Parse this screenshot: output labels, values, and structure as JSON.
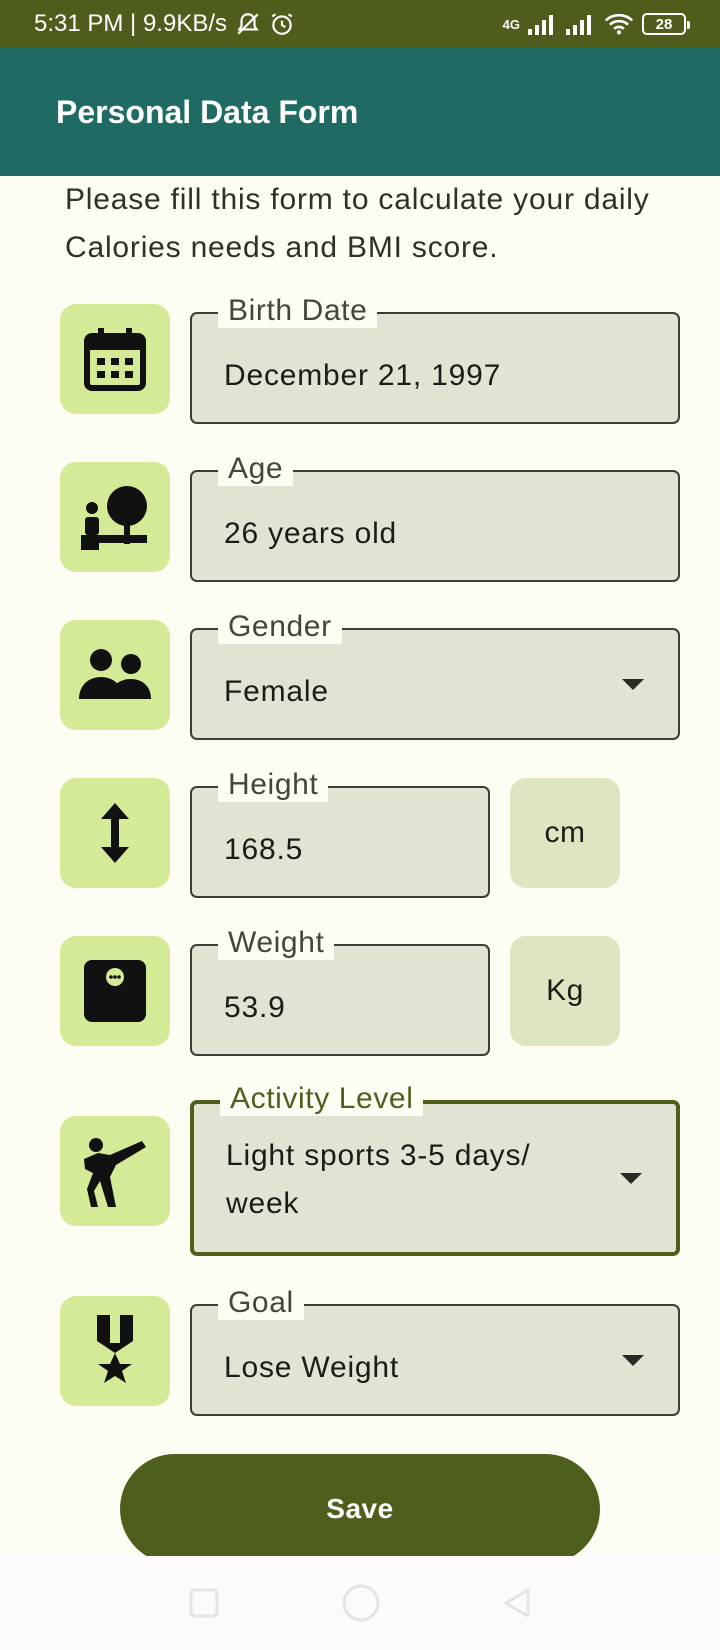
{
  "status_bar": {
    "time_speed": "5:31 PM | 9.9KB/s",
    "network": "4G",
    "battery": "28"
  },
  "app_bar": {
    "title": "Personal Data Form"
  },
  "intro_text": "Please fill this form to calculate your daily Calories needs and BMI score.",
  "fields": {
    "birth_date": {
      "label": "Birth Date",
      "value": "December 21, 1997",
      "icon": "calendar-icon"
    },
    "age": {
      "label": "Age",
      "value": "26 years old",
      "icon": "child-tree-icon"
    },
    "gender": {
      "label": "Gender",
      "value": "Female",
      "icon": "people-icon"
    },
    "height": {
      "label": "Height",
      "value": "168.5",
      "unit": "cm",
      "icon": "height-arrow-icon"
    },
    "weight": {
      "label": "Weight",
      "value": "53.9",
      "unit": "Kg",
      "icon": "scale-icon"
    },
    "activity": {
      "label": "Activity Level",
      "value": "Light sports 3-5 days/ week",
      "icon": "kick-icon"
    },
    "goal": {
      "label": "Goal",
      "value": "Lose Weight",
      "icon": "medal-icon"
    }
  },
  "save_label": "Save",
  "colors": {
    "status_bar": "#4e5d1b",
    "app_bar": "#1f6b63",
    "icon_box": "#d5ea96",
    "field_bg": "#e1e4d2",
    "button": "#4e5f1d",
    "background": "#fdfdf3"
  }
}
